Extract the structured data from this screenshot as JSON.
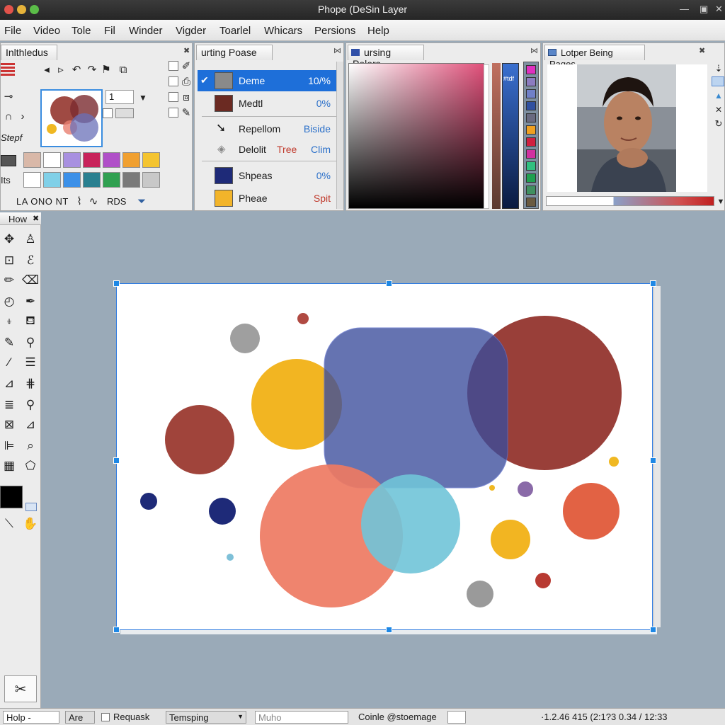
{
  "window": {
    "title": "Phope (DeSin Layer"
  },
  "menu": [
    "File",
    "Video",
    "Tole",
    "Fil",
    "Winder",
    "Vigder",
    "Toarlel",
    "Whicars",
    "Persions",
    "Help"
  ],
  "panels": {
    "brushes": {
      "tab": "Inlthledus",
      "size_value": "1",
      "labels_row": "LA  ONO  NT",
      "side_label": "Stepf",
      "side_label2": "Its",
      "suffix": "RDS"
    },
    "layers": {
      "tab": "urting Poase",
      "rows": [
        {
          "name": "Deme",
          "value": "10/%",
          "selected": true,
          "color": "#8a8a8a"
        },
        {
          "name": "Medtl",
          "value": "0%",
          "color": "#6b2a22"
        },
        {
          "name": "Repellom",
          "value": "Biside"
        },
        {
          "name": "Delolit",
          "value": "Tree",
          "value2": "Clim"
        },
        {
          "name": "Shpeas",
          "value": "0%",
          "color": "#1e2a78"
        },
        {
          "name": "Pheae",
          "value": "Spit",
          "color": "#f2b42a"
        }
      ]
    },
    "colors": {
      "tab": "ursing Polors",
      "hex_label": "#tdf"
    },
    "pages": {
      "tab": "Lotper Being Pages"
    },
    "tools": {
      "tab": "How"
    }
  },
  "swatches": {
    "row1": [
      "#d9b8a8",
      "#ffffff",
      "#a890e0",
      "#c8235a",
      "#b050c8",
      "#f0a030",
      "#f4c430"
    ],
    "row2": [
      "#ffffff",
      "#80d0e8",
      "#3c90e8",
      "#2a8090",
      "#30a050",
      "#7a7a7a",
      "#c8c8c8"
    ]
  },
  "palette_strip": [
    "#e030c0",
    "#8c7cc0",
    "#7080c8",
    "#3050a0",
    "#6a6a80",
    "#f0a020",
    "#d02040",
    "#d030a0",
    "#30c080",
    "#20a050",
    "#409060",
    "#6a5a40"
  ],
  "status": {
    "help": "Holp -",
    "are": "Are",
    "request": "Requask",
    "temping": "Temsping",
    "mode_placeholder": "Muho",
    "coords_label": "Coinle @stoemage",
    "readout": "·1.2.46 415 (2:1?3 0.34 / 12:33"
  },
  "colors": {
    "accent": "#1e6fd9",
    "canvas_bg": "#ffffff",
    "workspace": "#9aaab8"
  },
  "icons": [
    "arrow-left-icon",
    "arrow-right-icon",
    "pencil-icon",
    "eraser-icon",
    "zoom-icon",
    "lasso-icon",
    "brush-icon",
    "pen-tool-icon",
    "hand-icon",
    "eyedropper-icon"
  ]
}
